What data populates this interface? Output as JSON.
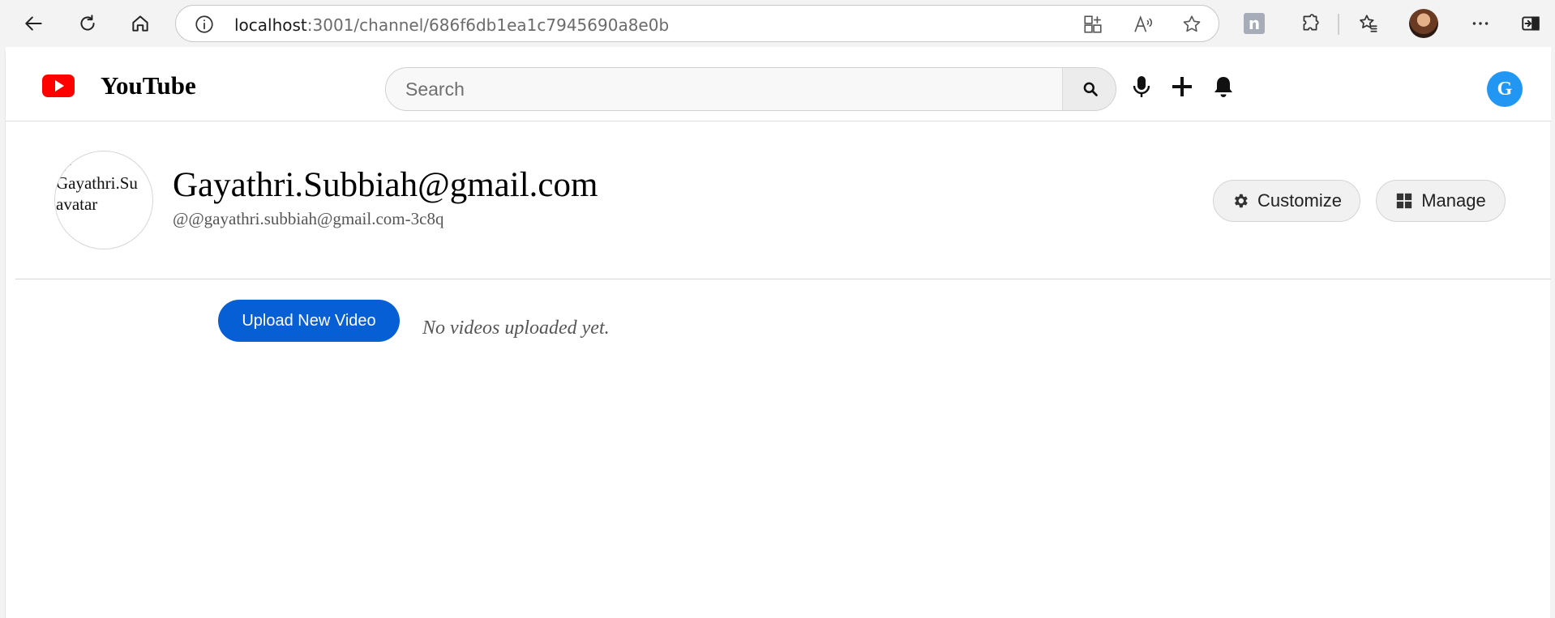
{
  "browser": {
    "url_host": "localhost",
    "url_path": ":3001/channel/686f6db1ea1c7945690a8e0b",
    "extension_badge": "n"
  },
  "header": {
    "logo_text": "YouTube",
    "search_placeholder": "Search",
    "user_initial": "G",
    "brand_color": "#ff0000",
    "avatar_color": "#2196f3"
  },
  "channel": {
    "avatar_alt": "Gayathri.Subbiah@gmail.com avatar",
    "avatar_alt_lines": "Gayathri.Su\navatar",
    "name": "Gayathri.Subbiah@gmail.com",
    "handle": "@@gayathri.subbiah@gmail.com-3c8q",
    "customize_label": "Customize",
    "manage_label": "Manage"
  },
  "content": {
    "upload_label": "Upload New Video",
    "empty_message": "No videos uploaded yet.",
    "accent_color": "#065fd4"
  }
}
